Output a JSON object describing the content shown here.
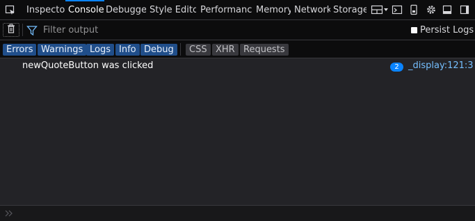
{
  "tabs": [
    {
      "label": "Inspector",
      "selected": false
    },
    {
      "label": "Console",
      "selected": true
    },
    {
      "label": "Debugger",
      "selected": false
    },
    {
      "label": "Style Editor",
      "selected": false
    },
    {
      "label": "Performance",
      "selected": false
    },
    {
      "label": "Memory",
      "selected": false
    },
    {
      "label": "Network",
      "selected": false
    },
    {
      "label": "Storage",
      "selected": false
    }
  ],
  "toolbar_icons": [
    "element-picker-icon",
    "responsive-layout-icon",
    "split-console-icon",
    "device-icon",
    "settings-gear-icon",
    "dock-bottom-icon",
    "dock-side-icon"
  ],
  "toolbar": {
    "filter_placeholder": "Filter output",
    "persist_label": "Persist Logs"
  },
  "filters": {
    "levels": [
      {
        "label": "Errors",
        "active": true
      },
      {
        "label": "Warnings",
        "active": true
      },
      {
        "label": "Logs",
        "active": true
      },
      {
        "label": "Info",
        "active": true
      },
      {
        "label": "Debug",
        "active": true
      }
    ],
    "types": [
      {
        "label": "CSS",
        "active": false
      },
      {
        "label": "XHR",
        "active": false
      },
      {
        "label": "Requests",
        "active": false
      }
    ]
  },
  "messages": [
    {
      "text": "newQuoteButton was clicked",
      "repeat": "2",
      "location": "_display:121:3"
    }
  ],
  "colors": {
    "accent": "#0a84ff",
    "filter_active": "#204e8a",
    "link": "#75bfff",
    "background": "#232327",
    "toolbar": "#0c0c0d"
  }
}
